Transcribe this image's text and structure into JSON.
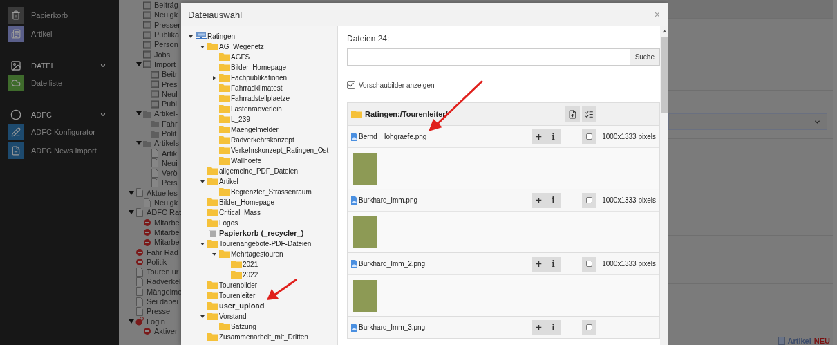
{
  "sidebar": {
    "items": [
      {
        "kind": "module",
        "label": "Papierkorb",
        "color": "#3a3a3a"
      },
      {
        "kind": "module",
        "label": "Artikel",
        "color": "#5a5f8a"
      },
      {
        "kind": "section",
        "label": "DATEI"
      },
      {
        "kind": "module",
        "label": "Dateiliste",
        "color": "#3f6b2c"
      },
      {
        "kind": "section",
        "label": "ADFC"
      },
      {
        "kind": "module",
        "label": "ADFC Konfigurator",
        "color": "#1d4a6e"
      },
      {
        "kind": "module",
        "label": "ADFC News Import",
        "color": "#1d4a6e"
      }
    ]
  },
  "page_tree": {
    "scrolled_group": [
      {
        "label": "Beiträg",
        "kind": "record-folder"
      },
      {
        "label": "Neuigk",
        "kind": "record-folder"
      },
      {
        "label": "Presser",
        "kind": "record-folder"
      },
      {
        "label": "Publika",
        "kind": "record-folder"
      },
      {
        "label": "Person",
        "kind": "record-folder"
      },
      {
        "label": "Jobs",
        "kind": "record-folder"
      },
      {
        "label": "Import",
        "kind": "record-folder",
        "expanded": true,
        "children": [
          {
            "label": "Beitr",
            "kind": "record-folder"
          },
          {
            "label": "Pres",
            "kind": "record-folder"
          },
          {
            "label": "Neul",
            "kind": "record-folder"
          },
          {
            "label": "Publ",
            "kind": "record-folder"
          }
        ]
      },
      {
        "label": "Artikel-",
        "kind": "folder",
        "expanded": true,
        "children": [
          {
            "label": "Fahr",
            "kind": "folder"
          },
          {
            "label": "Polit",
            "kind": "folder"
          }
        ]
      },
      {
        "label": "Artikels",
        "kind": "folder",
        "expanded": true,
        "children": [
          {
            "label": "Artik",
            "kind": "page"
          },
          {
            "label": "Neui",
            "kind": "page"
          },
          {
            "label": "Verö",
            "kind": "page"
          },
          {
            "label": "Pers",
            "kind": "page"
          }
        ]
      }
    ],
    "items": [
      {
        "label": "Aktuelles",
        "kind": "page",
        "expanded": true,
        "children": [
          {
            "label": "Neuigk",
            "kind": "page"
          }
        ]
      },
      {
        "label": "ADFC Rat",
        "kind": "page",
        "expanded": true,
        "children": [
          {
            "label": "Mitarbe",
            "kind": "hidden-page"
          },
          {
            "label": "Mitarbe",
            "kind": "hidden-page"
          },
          {
            "label": "Mitarbe",
            "kind": "hidden-page"
          }
        ]
      },
      {
        "label": "Fahr Rad",
        "kind": "hidden-page"
      },
      {
        "label": "Politik",
        "kind": "hidden-page"
      },
      {
        "label": "Touren ur",
        "kind": "page"
      },
      {
        "label": "Radverkel",
        "kind": "page"
      },
      {
        "label": "Mängelme",
        "kind": "page"
      },
      {
        "label": "Sei dabei",
        "kind": "page"
      },
      {
        "label": "Presse",
        "kind": "page"
      },
      {
        "label": "Login",
        "kind": "login-page",
        "expanded": true,
        "children": [
          {
            "label": "Aktiver",
            "kind": "hidden-page"
          }
        ]
      }
    ]
  },
  "modal": {
    "title": "Dateiauswahl",
    "close": "×",
    "folder_tree": [
      {
        "label": "Ratingen",
        "kind": "storage",
        "expanded": true,
        "selected": false,
        "children": [
          {
            "label": "AG_Wegenetz",
            "kind": "folder",
            "expanded": true,
            "selected": false,
            "children": [
              {
                "label": "AGFS",
                "kind": "folder",
                "selected": false
              },
              {
                "label": "Bilder_Homepage",
                "kind": "folder",
                "selected": false
              },
              {
                "label": "Fachpublikationen",
                "kind": "folder",
                "expanded": false,
                "selected": false
              },
              {
                "label": "Fahrradklimatest",
                "kind": "folder",
                "selected": false
              },
              {
                "label": "Fahrradstellplaetze",
                "kind": "folder",
                "selected": false
              },
              {
                "label": "Lastenradverleih",
                "kind": "folder",
                "selected": false
              },
              {
                "label": "L_239",
                "kind": "folder",
                "selected": false
              },
              {
                "label": "Maengelmelder",
                "kind": "folder",
                "selected": false
              },
              {
                "label": "Radverkehrskonzept",
                "kind": "folder",
                "selected": false
              },
              {
                "label": "Verkehrskonzept_Ratingen_Ost",
                "kind": "folder",
                "selected": false
              },
              {
                "label": "Wallhoefe",
                "kind": "folder",
                "selected": false
              }
            ]
          },
          {
            "label": "allgemeine_PDF_Dateien",
            "kind": "folder",
            "selected": false
          },
          {
            "label": "Artikel",
            "kind": "folder",
            "expanded": true,
            "selected": false,
            "children": [
              {
                "label": "Begrenzter_Strassenraum",
                "kind": "folder",
                "selected": false
              }
            ]
          },
          {
            "label": "Bilder_Homepage",
            "kind": "folder",
            "selected": false
          },
          {
            "label": "Critical_Mass",
            "kind": "folder",
            "selected": false
          },
          {
            "label": "Logos",
            "kind": "folder",
            "selected": false
          },
          {
            "label": "Papierkorb (_recycler_)",
            "kind": "recycler",
            "bold": true,
            "selected": false
          },
          {
            "label": "Tourenangebote-PDF-Dateien",
            "kind": "folder",
            "expanded": true,
            "selected": false,
            "children": [
              {
                "label": "Mehrtagestouren",
                "kind": "folder",
                "expanded": true,
                "selected": false,
                "children": [
                  {
                    "label": "2021",
                    "kind": "folder",
                    "selected": false
                  },
                  {
                    "label": "2022",
                    "kind": "folder",
                    "selected": false
                  }
                ]
              }
            ]
          },
          {
            "label": "Tourenbilder",
            "kind": "folder",
            "selected": false
          },
          {
            "label": "Tourenleiter",
            "kind": "folder",
            "selected": true
          },
          {
            "label": "user_upload",
            "kind": "folder",
            "bold": true,
            "selected": false
          },
          {
            "label": "Vorstand",
            "kind": "folder",
            "expanded": true,
            "selected": false,
            "children": [
              {
                "label": "Satzung",
                "kind": "folder",
                "selected": false
              }
            ]
          },
          {
            "label": "Zusammenarbeit_mit_Dritten",
            "kind": "folder",
            "selected": false
          }
        ]
      }
    ],
    "files_heading": "Dateien 24:",
    "search": {
      "button": "Suche"
    },
    "show_thumbnails": {
      "label": "Vorschaubilder anzeigen",
      "checked": true
    },
    "folder_path": "Ratingen:/Tourenleiter/",
    "files": [
      {
        "name": "Bernd_Hohgraefe.png",
        "add": "+",
        "info": "i",
        "checked": false,
        "dimensions": "1000x1333 pixels",
        "thumbnail": true
      },
      {
        "name": "Burkhard_Imm.png",
        "add": "+",
        "info": "i",
        "checked": false,
        "dimensions": "1000x1333 pixels",
        "thumbnail": true
      },
      {
        "name": "Burkhard_Imm_2.png",
        "add": "+",
        "info": "i",
        "checked": false,
        "dimensions": "1000x1333 pixels",
        "thumbnail": true
      },
      {
        "name": "Burkhard_Imm_3.png",
        "add": "+",
        "info": "i",
        "checked": false
      }
    ]
  },
  "footer_link": {
    "label": "Artikel",
    "badge": "NEU"
  }
}
